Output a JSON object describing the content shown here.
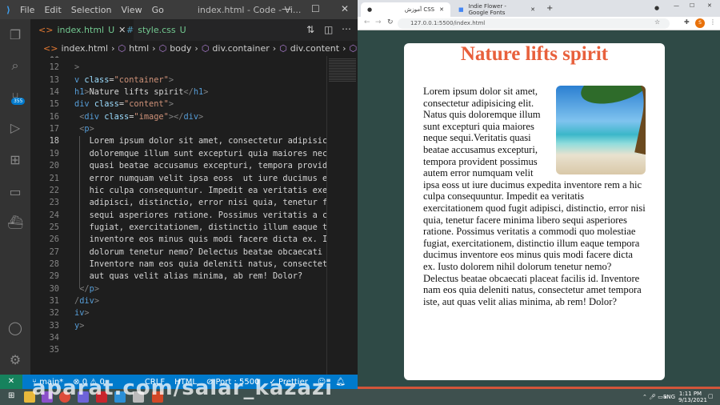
{
  "vscode": {
    "menu": [
      "File",
      "Edit",
      "Selection",
      "View",
      "Go"
    ],
    "window_title": "index.html - Code - Vi...",
    "scm_badge": "355",
    "tabs": [
      {
        "label": "index.html",
        "status": "U",
        "icon": "html-file-icon"
      },
      {
        "label": "style.css",
        "status": "U",
        "icon": "css-file-icon"
      }
    ],
    "breadcrumb": [
      "index.html",
      "html",
      "body",
      "div.container",
      "div.content",
      "p"
    ],
    "lines": [
      {
        "n": "11",
        "html": ""
      },
      {
        "n": "12",
        "html": "<span class='pn'>></span>"
      },
      {
        "n": "13",
        "html": "<span class='tg'>v</span> <span class='at'>class</span>=<span class='st'>\"container\"</span><span class='pn'>></span>"
      },
      {
        "n": "14",
        "html": "<span class='tg'>h1</span><span class='pn'>></span>Nature lifts spirit<span class='pn'>&lt;/</span><span class='tg'>h1</span><span class='pn'>></span>"
      },
      {
        "n": "15",
        "html": "<span class='tg'>div</span> <span class='at'>class</span>=<span class='st'>\"content\"</span><span class='pn'>></span>"
      },
      {
        "n": "16",
        "html": " <span class='pn'>&lt;</span><span class='tg'>div</span> <span class='at'>class</span>=<span class='st'>\"image\"</span><span class='pn'>>&lt;/</span><span class='tg'>div</span><span class='pn'>></span>"
      },
      {
        "n": "17",
        "html": " <span class='pn'>&lt;</span><span class='tg'>p</span><span class='pn'>></span>"
      },
      {
        "n": "18",
        "html": "   Lorem ipsum dolor sit amet, consectetur adipisic"
      },
      {
        "n": "19",
        "html": "   doloremque illum sunt excepturi quia maiores nec"
      },
      {
        "n": "20",
        "html": "   quasi beatae accusamus excepturi, tempora provid"
      },
      {
        "n": "21",
        "html": "   error numquam velit ipsa eoss  ut iure ducimus e"
      },
      {
        "n": "22",
        "html": "   hic culpa consequuntur. Impedit ea veritatis exe"
      },
      {
        "n": "23",
        "html": "   adipisci, distinctio, error nisi quia, tenetur f"
      },
      {
        "n": "24",
        "html": "   sequi asperiores ratione. Possimus veritatis a c"
      },
      {
        "n": "25",
        "html": "   fugiat, exercitationem, distinctio illum eaque t"
      },
      {
        "n": "26",
        "html": "   inventore eos minus quis modi facere dicta ex. I"
      },
      {
        "n": "27",
        "html": "   dolorum tenetur nemo? Delectus beatae obcaecati "
      },
      {
        "n": "28",
        "html": "   Inventore nam eos quia deleniti natus, consectet"
      },
      {
        "n": "29",
        "html": "   aut quas velit alias minima, ab rem! Dolor?"
      },
      {
        "n": "30",
        "html": " <span class='pn'>&lt;/</span><span class='tg'>p</span><span class='pn'>></span>"
      },
      {
        "n": "31",
        "html": "<span class='pn'>/</span><span class='tg'>div</span><span class='pn'>></span>"
      },
      {
        "n": "32",
        "html": "<span class='tg'>iv</span><span class='pn'>></span>"
      },
      {
        "n": "33",
        "html": "<span class='tg'>y</span><span class='pn'>></span>"
      },
      {
        "n": "34",
        "html": ""
      },
      {
        "n": "35",
        "html": ""
      }
    ],
    "current_line": "18",
    "status": {
      "branch": "main*",
      "errors": "0",
      "warnings": "0",
      "eol": "CRLF",
      "language": "HTML",
      "port": "Port : 5500",
      "prettier": "Prettier"
    }
  },
  "browser": {
    "tabs": [
      {
        "label": "آموزش CSS"
      },
      {
        "label": "Indie Flower - Google Fonts"
      }
    ],
    "url": "127.0.0.1:5500/index.html",
    "profile_initial": "S",
    "page": {
      "title": "Nature lifts spirit",
      "paragraph": "Lorem ipsum dolor sit amet, consectetur adipisicing elit. Natus quis doloremque illum sunt excepturi quia maiores neque sequi.Veritatis quasi beatae accusamus excepturi, tempora provident possimus autem error numquam velit ipsa eoss ut iure ducimus expedita inventore rem a hic culpa consequuntur. Impedit ea veritatis exercitationem quod fugit adipisci, distinctio, error nisi quia, tenetur facere minima libero sequi asperiores ratione. Possimus veritatis a commodi quo molestiae fugiat, exercitationem, distinctio illum eaque tempora ducimus inventore eos minus quis modi facere dicta ex. Iusto dolorem nihil dolorum tenetur nemo? Delectus beatae obcaecati placeat facilis id. Inventore nam eos quia deleniti natus, consectetur amet tempora iste, aut quas velit alias minima, ab rem! Dolor?",
      "title_color": "#e8603c"
    }
  },
  "taskbar": {
    "language": "ENG",
    "time": "1:11 PM",
    "date": "9/13/2021"
  },
  "watermark": "aparat.com/salar_kazazi"
}
